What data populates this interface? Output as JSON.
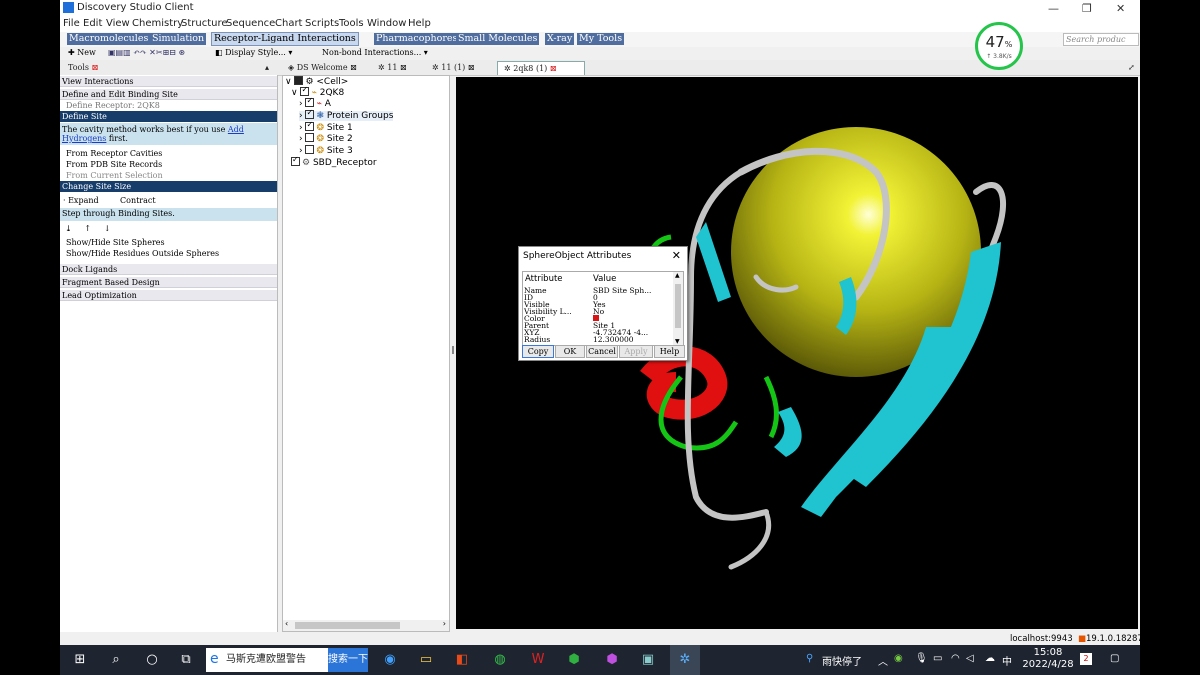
{
  "window": {
    "title": "Discovery Studio Client",
    "minimize": "—",
    "restore": "❐",
    "close": "✕"
  },
  "menu": [
    "File",
    "Edit",
    "View",
    "Chemistry",
    "Structure",
    "Sequence",
    "Chart",
    "Scripts",
    "Tools",
    "Window",
    "Help"
  ],
  "modules": [
    {
      "label": "Macromolecules",
      "state": "blue"
    },
    {
      "label": "Simulation",
      "state": "blue"
    },
    {
      "label": "Receptor-Ligand Interactions",
      "state": "active"
    },
    {
      "label": "Pharmacophores",
      "state": "blue"
    },
    {
      "label": "Small Molecules",
      "state": "blue"
    },
    {
      "label": "X-ray",
      "state": "blue"
    },
    {
      "label": "My Tools",
      "state": "blue"
    }
  ],
  "search_placeholder": "Search produc",
  "toolbar": {
    "new_label": "New",
    "display_style": "Display Style...",
    "nonbond": "Non-bond Interactions..."
  },
  "tabs": [
    {
      "label": "DS Welcome",
      "selected": false
    },
    {
      "label": "11",
      "selected": false
    },
    {
      "label": "11 (1)",
      "selected": false
    },
    {
      "label": "2qk8 (1)",
      "selected": true
    }
  ],
  "tools": {
    "header": "Tools",
    "view_interactions": "View Interactions",
    "define_edit": "Define and Edit Binding Site",
    "define_receptor": "Define Receptor: 2QK8",
    "define_site": "Define Site",
    "cavity_hint_1": "The cavity method works best if you use ",
    "cavity_hint_link": "Add Hydrogens",
    "cavity_hint_2": " first.",
    "from_cavities": "From Receptor Cavities",
    "from_pdb": "From PDB Site Records",
    "from_selection": "From Current Selection",
    "change_size": "Change Site Size",
    "expand": "Expand",
    "contract": "Contract",
    "step_through": "Step through Binding Sites.",
    "show_hide_spheres": "Show/Hide Site Spheres",
    "show_hide_residues": "Show/Hide Residues Outside Spheres",
    "dock_ligands": "Dock Ligands",
    "fragment_design": "Fragment Based Design",
    "lead_opt": "Lead Optimization"
  },
  "tree": {
    "cell": "<Cell>",
    "protein": "2QK8",
    "chain": "A",
    "groups": "Protein Groups",
    "site1": "Site 1",
    "site2": "Site 2",
    "site3": "Site 3",
    "receptor": "SBD_Receptor"
  },
  "dialog": {
    "title": "SphereObject Attributes",
    "col_attr": "Attribute",
    "col_value": "Value",
    "rows": [
      {
        "attr": "Name",
        "value": "SBD Site Sph..."
      },
      {
        "attr": "ID",
        "value": "0"
      },
      {
        "attr": "Visible",
        "value": "Yes"
      },
      {
        "attr": "Visibility L...",
        "value": "No"
      },
      {
        "attr": "Color",
        "value": ""
      },
      {
        "attr": "Parent",
        "value": "Site 1"
      },
      {
        "attr": "XYZ",
        "value": "-4.732474 -4..."
      },
      {
        "attr": "Radius",
        "value": "12.300000"
      }
    ],
    "color_value": "#d81414",
    "buttons": {
      "copy": "Copy",
      "ok": "OK",
      "cancel": "Cancel",
      "apply": "Apply",
      "help": "Help"
    }
  },
  "status": {
    "host": "localhost:9943",
    "version": "19.1.0.18287"
  },
  "gauge": {
    "percent": "47",
    "unit": "%",
    "speed": "↑ 3.8K/s"
  },
  "taskbar": {
    "search_text": "马斯克遭欧盟警告",
    "search_button": "搜索一下",
    "weather": "雨快停了",
    "ime": "中",
    "time": "15:08",
    "date": "2022/4/28",
    "notif": "2"
  }
}
